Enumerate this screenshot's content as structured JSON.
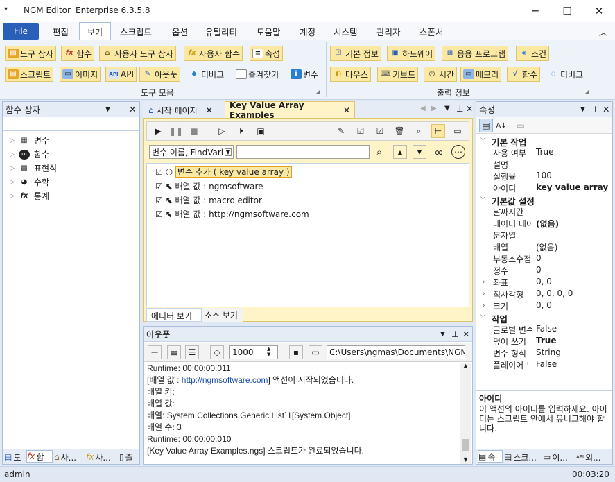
{
  "app": {
    "title": "NGM Editor",
    "edition": "Enterprise 6.3.5.8",
    "status_user": "admin",
    "status_time": "00:03:20"
  },
  "menu": {
    "file": "File",
    "items": [
      "편집",
      "보기",
      "스크립트",
      "옵션",
      "유틸리티",
      "도움말",
      "계정",
      "시스템",
      "관리자",
      "스폰서"
    ]
  },
  "ribbon": {
    "row1_left": [
      "도구 상자",
      "함수",
      "사용자 도구 상자",
      "사용자 함수",
      "속성"
    ],
    "row2_left": [
      "스크립트",
      "이미지",
      "API",
      "아웃풋",
      "디버그",
      "즐겨찾기",
      "변수"
    ],
    "group_left": "도구 모음",
    "row1_right": [
      "기본 정보",
      "하드웨어",
      "응용 프로그램",
      "조건"
    ],
    "row2_right": [
      "마우스",
      "키보드",
      "시간",
      "메모리",
      "함수",
      "디버그"
    ],
    "group_right": "출력 정보"
  },
  "left_panel": {
    "title": "함수 상자",
    "items": [
      "변수",
      "함수",
      "표현식",
      "수학",
      "통계"
    ],
    "bottom_tabs": [
      "도",
      "함",
      "사...",
      "사...",
      "즐"
    ]
  },
  "doc_tabs": [
    "시작 페이지",
    "Key Value Array Examples"
  ],
  "editor": {
    "search_dropdown": "변수 이름, FindVari",
    "search_value": "",
    "lines": [
      "변수 추가 ( key value array )",
      "배열 값 : ngmsoftware",
      "배열 값 : macro editor",
      "배열 값 : http://ngmsoftware.com"
    ],
    "view_tabs": [
      "에디터 보기",
      "소스 보기"
    ]
  },
  "output": {
    "title": "아웃풋",
    "count": "1000",
    "path": "C:\\Users\\ngmas\\Documents\\NGM6\\",
    "lines": [
      "Runtime: 00:00:00.011",
      "[배열 값 : |http://ngmsoftware.com|] 액션이 시작되었습니다.",
      "배열 키:",
      "배열 값:",
      "배열: System.Collections.Generic.List`1[System.Object]",
      "배열 수: 3",
      "Runtime: 00:00:00.010",
      "[Key Value Array Examples.ngs] 스크립트가 완료되었습니다."
    ]
  },
  "properties": {
    "title": "속성",
    "cats": [
      {
        "name": "기본 작업",
        "rows": [
          [
            "사용 여부",
            "True"
          ],
          [
            "설명",
            ""
          ],
          [
            "실행율",
            "100"
          ],
          [
            "아이디",
            "key value array"
          ]
        ]
      },
      {
        "name": "기본값 설정",
        "rows": [
          [
            "날짜시간",
            ""
          ],
          [
            "데이터 테이블",
            "(없음)"
          ],
          [
            "문자열",
            ""
          ],
          [
            "배열",
            "(없음)"
          ],
          [
            "부동소수점",
            "0"
          ],
          [
            "정수",
            "0"
          ],
          [
            "좌표",
            "0, 0"
          ],
          [
            "직사각형",
            "0, 0, 0, 0"
          ],
          [
            "크기",
            "0, 0"
          ]
        ]
      },
      {
        "name": "작업",
        "rows": [
          [
            "글로벌 변수",
            "False"
          ],
          [
            "덮어 쓰기",
            "True"
          ],
          [
            "변수 형식",
            "String"
          ],
          [
            "플레이어 노출",
            "False"
          ]
        ]
      }
    ],
    "desc_title": "아이디",
    "desc_text": "이 액션의 아이디를 입력하세요. 아이디는 스크립트 안에서 유니크해야 합니다.",
    "bottom_tabs": [
      "속",
      "스크...",
      "이...",
      "외..."
    ]
  },
  "colors": {
    "accent": "#2a5fb7",
    "highlight": "#fbe9a3"
  }
}
